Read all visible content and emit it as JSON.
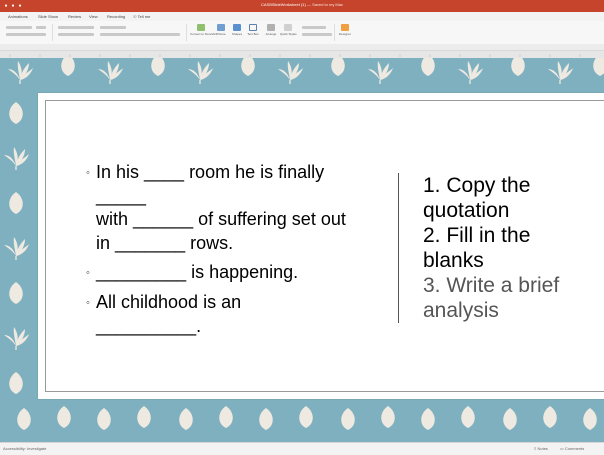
{
  "titlebar": {
    "document_name": "CASBSlideWorksheet (1)",
    "saved_status": "— Saved to my Mac"
  },
  "ribbon_tabs": [
    "Animations",
    "Slide Show",
    "Review",
    "View",
    "Recording",
    "Tell me"
  ],
  "ribbon_buttons": {
    "convert_smartart": "Convert to SmartArt",
    "picture": "Picture",
    "shapes": "Shapes",
    "text_box": "Text Box",
    "arrange": "Arrange",
    "quick_styles": "Quick Styles",
    "designer": "Designer"
  },
  "slide": {
    "bullets": [
      {
        "lines": [
          "In his ____ room he is finally",
          "_____",
          "with ______ of suffering set out",
          "in _______ rows."
        ]
      },
      {
        "lines": [
          "_________ is happening."
        ]
      },
      {
        "lines": [
          "All childhood is an",
          "__________."
        ]
      }
    ],
    "steps": [
      "1. Copy the",
      "quotation",
      "2. Fill in the",
      "blanks",
      "3. Write a brief",
      "analysis"
    ]
  },
  "statusbar": {
    "left": "Notes",
    "accessibility": "Accessibility: Investigate",
    "right_notes": "Notes",
    "right_comments": "Comments"
  },
  "colors": {
    "title_bar": "#c5442b",
    "slide_background": "#7fb0bf",
    "pattern": "#efeae1"
  },
  "icons": [
    "close-icon",
    "minimize-icon",
    "maximize-icon",
    "lightbulb-icon",
    "picture-icon",
    "shapes-icon",
    "textbox-icon",
    "designer-icon",
    "notes-icon",
    "comments-icon"
  ]
}
